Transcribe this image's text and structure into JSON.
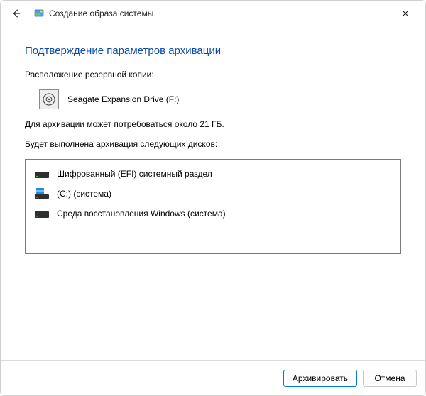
{
  "window": {
    "title": "Создание образа системы"
  },
  "page": {
    "heading": "Подтверждение параметров архивации",
    "backup_location_label": "Расположение резервной копии:",
    "destination": "Seagate Expansion Drive (F:)",
    "size_estimate": "Для архивации может потребоваться около 21 ГБ.",
    "disks_label": "Будет выполнена архивация следующих дисков:"
  },
  "disks": [
    {
      "label": "Шифрованный (EFI) системный раздел",
      "icon": "dark"
    },
    {
      "label": "(C:) (система)",
      "icon": "windows"
    },
    {
      "label": "Среда восстановления Windows (система)",
      "icon": "dark"
    }
  ],
  "footer": {
    "primary": "Архивировать",
    "cancel": "Отмена"
  }
}
